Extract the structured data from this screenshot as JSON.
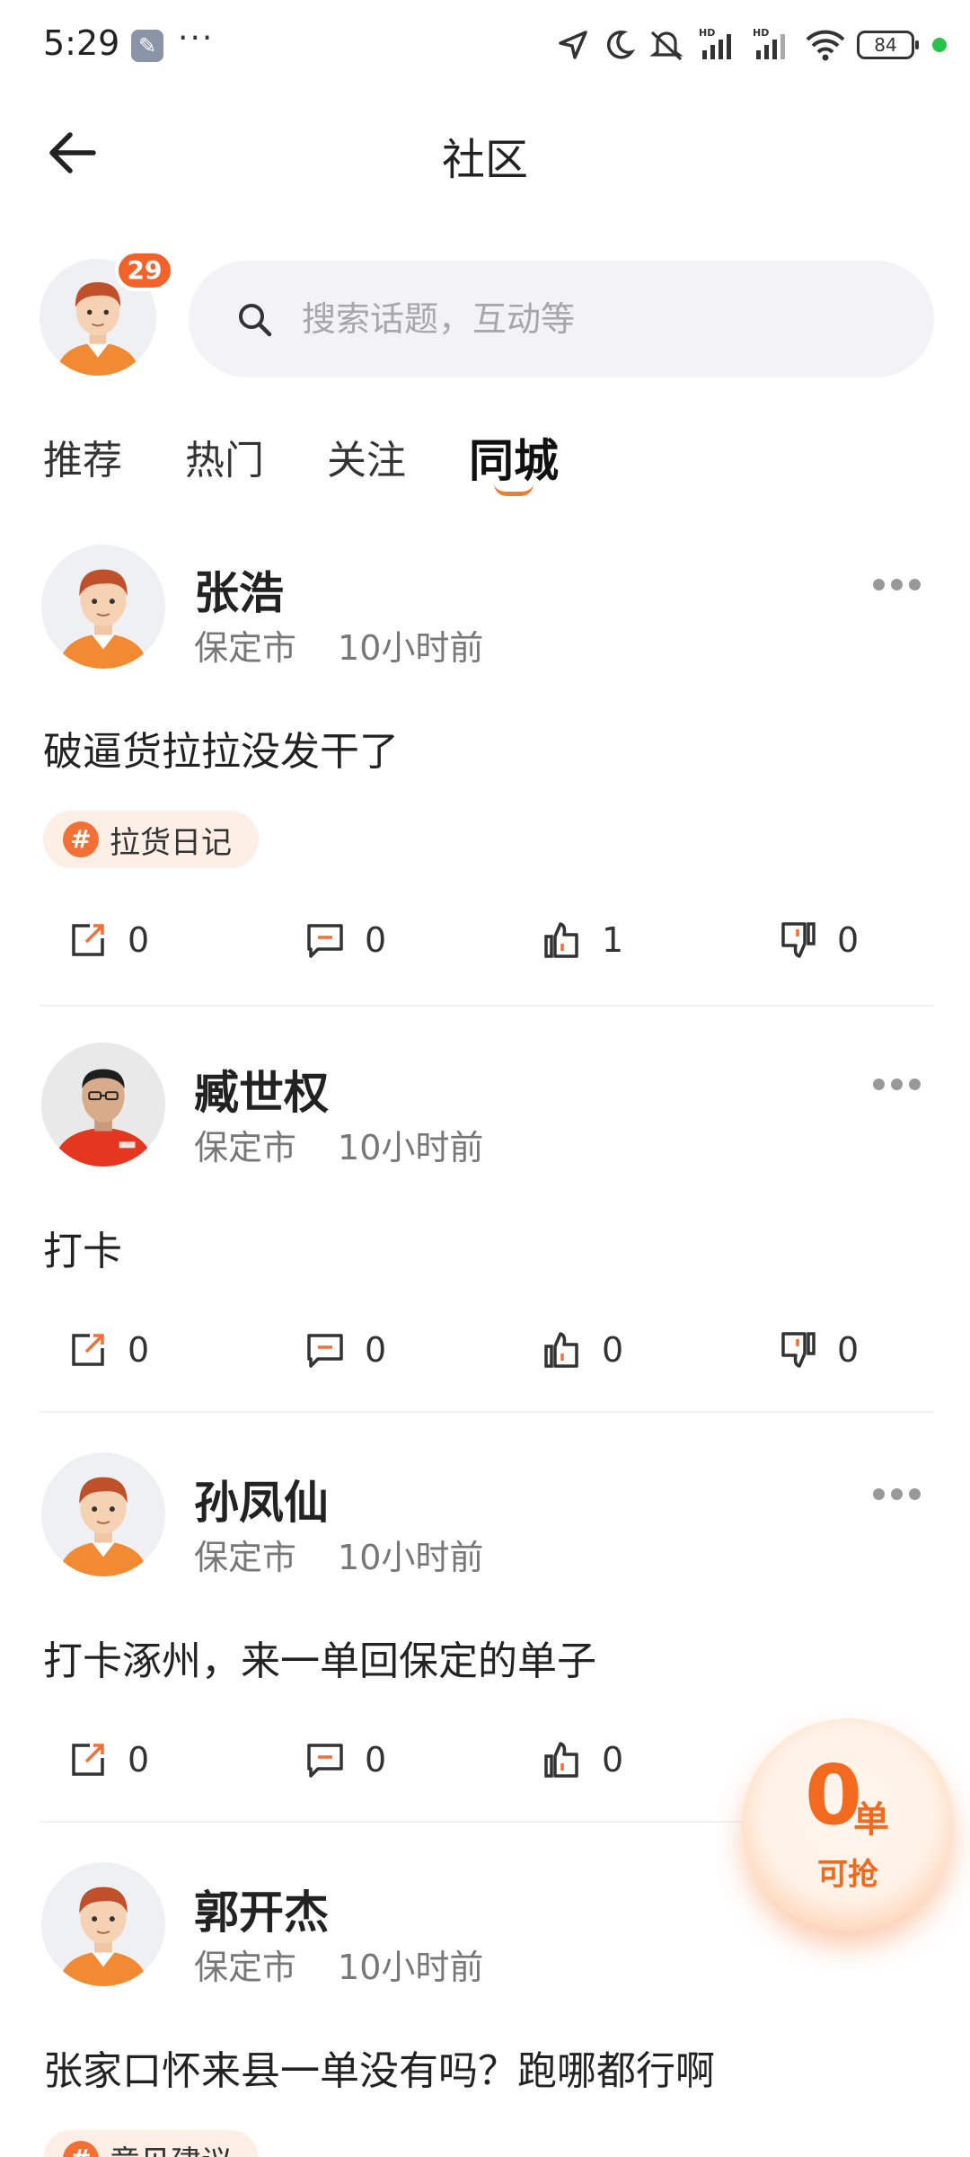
{
  "status_bar": {
    "time": "5:29",
    "more": "···",
    "battery": "84"
  },
  "header": {
    "title": "社区"
  },
  "me": {
    "badge_count": "29"
  },
  "search": {
    "placeholder": "搜索话题，互动等"
  },
  "tabs": [
    {
      "label": "推荐",
      "active": false
    },
    {
      "label": "热门",
      "active": false
    },
    {
      "label": "关注",
      "active": false
    },
    {
      "label": "同城",
      "active": true
    }
  ],
  "posts": [
    {
      "name": "张浩",
      "city": "保定市",
      "time": "10小时前",
      "content": "破逼货拉拉没发干了",
      "topic": "拉货日记",
      "share": "0",
      "comment": "0",
      "like": "1",
      "dislike": "0"
    },
    {
      "name": "臧世权",
      "city": "保定市",
      "time": "10小时前",
      "content": "打卡",
      "share": "0",
      "comment": "0",
      "like": "0",
      "dislike": "0"
    },
    {
      "name": "孙凤仙",
      "city": "保定市",
      "time": "10小时前",
      "content": "打卡涿州，来一单回保定的单子",
      "share": "0",
      "comment": "0",
      "like": "0"
    },
    {
      "name": "郭开杰",
      "city": "保定市",
      "time": "10小时前",
      "content": "张家口怀来县一单没有吗？跑哪都行啊",
      "topic": "意见建议"
    }
  ],
  "float_button": {
    "count": "0",
    "unit": "单",
    "label": "可抢"
  },
  "colors": {
    "accent": "#f57b2d",
    "badge": "#f2622a"
  }
}
